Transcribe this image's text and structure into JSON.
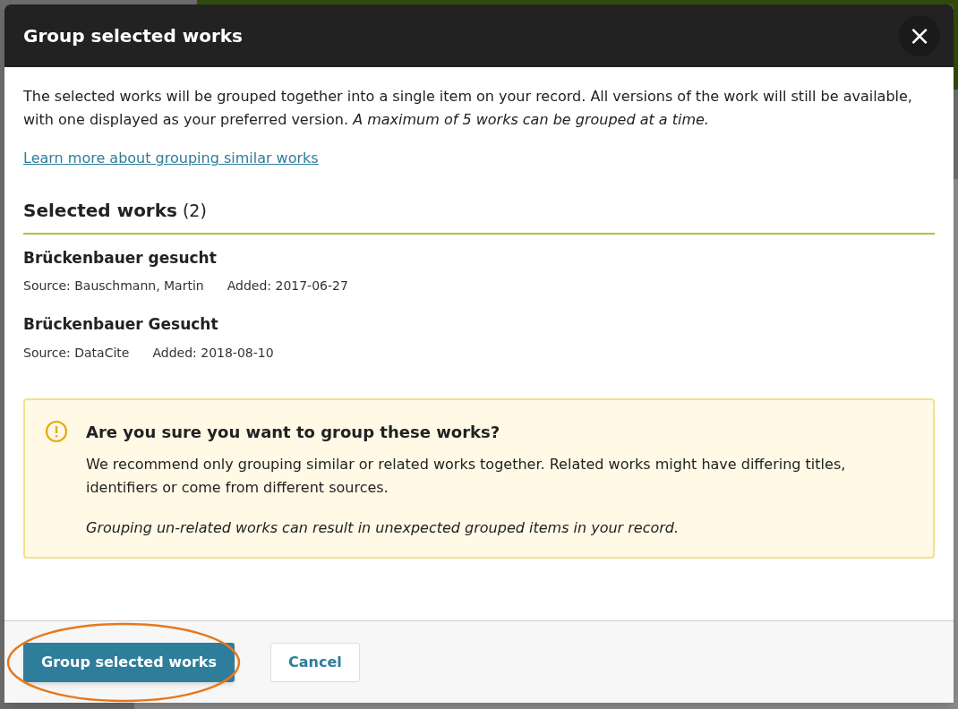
{
  "dialog": {
    "title": "Group selected works",
    "close_label": "×"
  },
  "intro": "The selected works will be grouped together into a single item on your record. All versions of the work will still be available, with one displayed as your preferred version. *A maximum of 5 works can be grouped at a time.*",
  "learn_more_link": "Learn more about grouping similar works",
  "selected_heading": {
    "title": "Selected works",
    "count": "(2)"
  },
  "works": [
    {
      "title": "Brückenbauer gesucht",
      "source": "Source: Bauschmann, Martin",
      "added": "Added: 2017-06-27"
    },
    {
      "title": "Brückenbauer Gesucht",
      "source": "Source: DataCite",
      "added": "Added: 2018-08-10"
    }
  ],
  "warning": {
    "title": "Are you sure you want to group these works?",
    "text": "We recommend only grouping similar or related works together. Related works might have differing titles, identifiers or come from different sources.",
    "note": "Grouping un-related works can result in unexpected grouped items in your record."
  },
  "buttons": [
    {
      "label": "Group selected works",
      "kind": "primary",
      "highlighted": true
    },
    {
      "label": "Cancel",
      "kind": "secondary",
      "highlighted": false
    }
  ]
}
